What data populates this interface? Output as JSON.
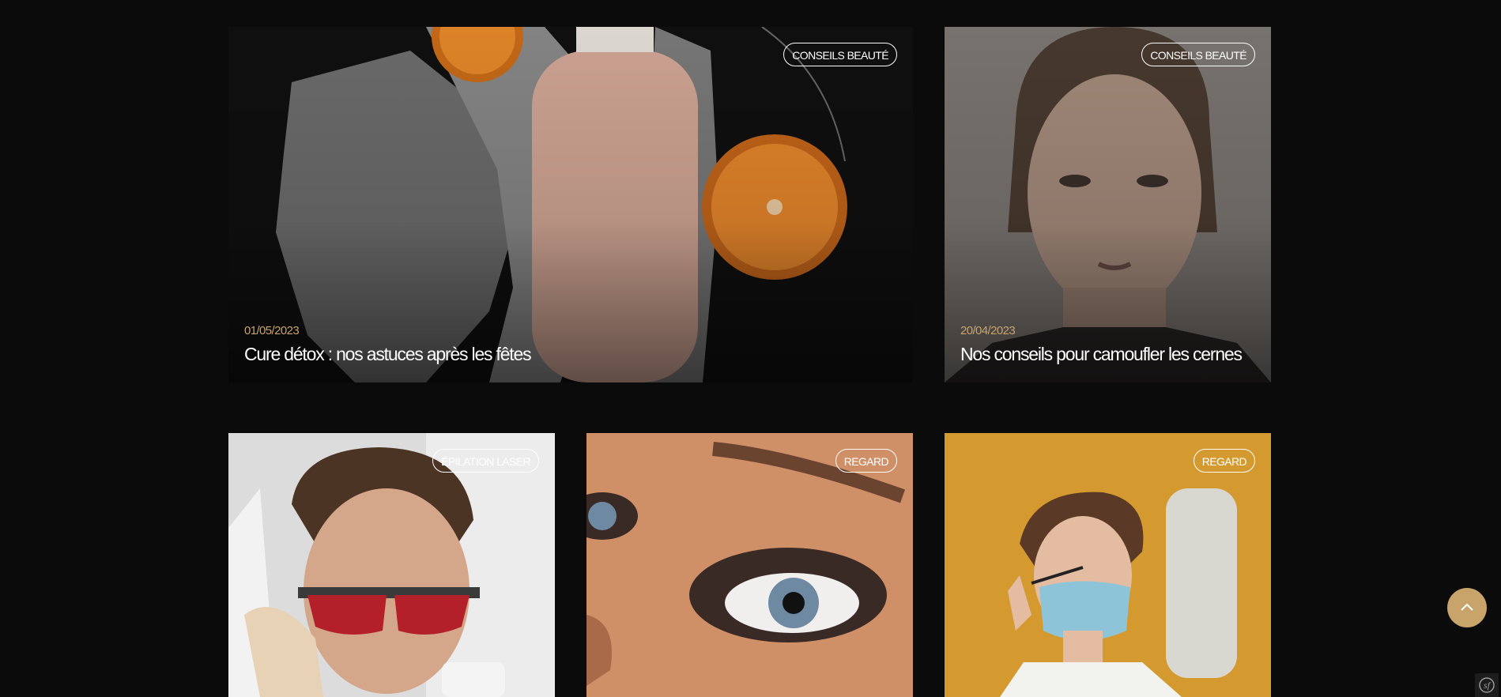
{
  "cards": [
    {
      "category": "CONSEILS BEAUTÉ",
      "date": "01/05/2023",
      "title": "Cure détox : nos astuces après les fêtes"
    },
    {
      "category": "CONSEILS BEAUTÉ",
      "date": "20/04/2023",
      "title": "Nos conseils pour camoufler les cernes"
    },
    {
      "category": "ÉPILATION LASER"
    },
    {
      "category": "REGARD"
    },
    {
      "category": "REGARD"
    }
  ],
  "icons": {
    "back_to_top": "chevron-up-icon",
    "dev_toolbar": "symfony-logo-icon"
  },
  "colors": {
    "background": "#0b0b0b",
    "accent": "#c9a46a",
    "text": "#ffffff"
  }
}
